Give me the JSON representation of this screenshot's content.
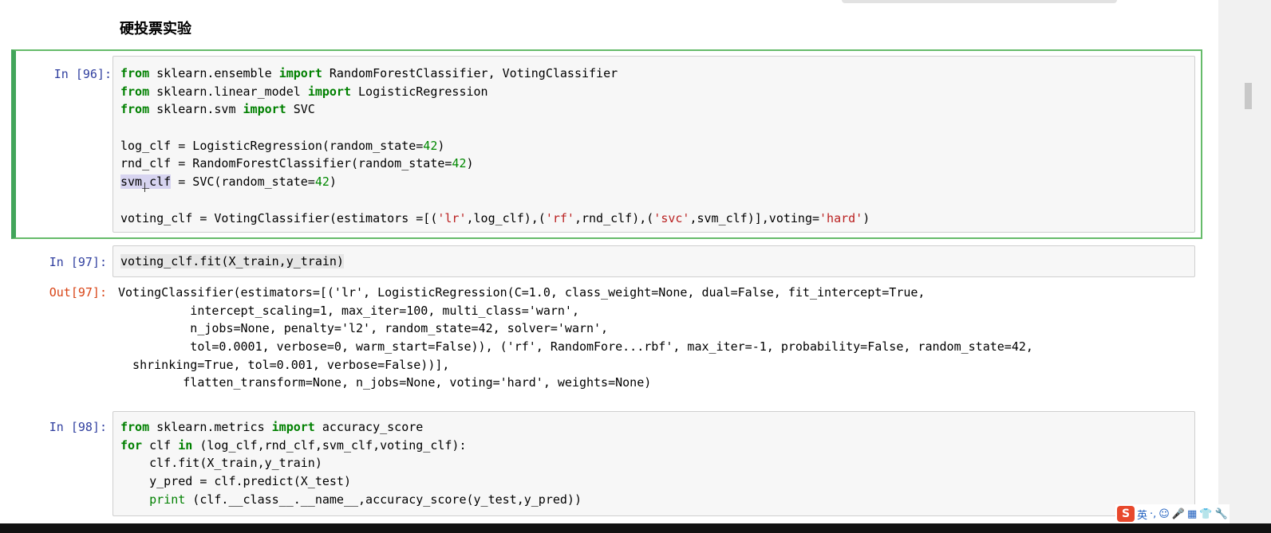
{
  "heading": "硬投票实验",
  "cells": [
    {
      "prompt": "In [96]:",
      "lines": [
        [
          {
            "t": "from",
            "c": "kw"
          },
          {
            "t": " sklearn.ensemble "
          },
          {
            "t": "import",
            "c": "kw"
          },
          {
            "t": " RandomForestClassifier, VotingClassifier"
          }
        ],
        [
          {
            "t": "from",
            "c": "kw"
          },
          {
            "t": " sklearn.linear_model "
          },
          {
            "t": "import",
            "c": "kw"
          },
          {
            "t": " LogisticRegression"
          }
        ],
        [
          {
            "t": "from",
            "c": "kw"
          },
          {
            "t": " sklearn.svm "
          },
          {
            "t": "import",
            "c": "kw"
          },
          {
            "t": " SVC"
          }
        ],
        [],
        [
          {
            "t": "log_clf = LogisticRegression(random_state="
          },
          {
            "t": "42",
            "c": "num"
          },
          {
            "t": ")"
          }
        ],
        [
          {
            "t": "rnd_clf = RandomForestClassifier(random_state="
          },
          {
            "t": "42",
            "c": "num"
          },
          {
            "t": ")"
          }
        ],
        [
          {
            "t": "svm_clf",
            "c": "sel-word"
          },
          {
            "t": " = SVC(random_state="
          },
          {
            "t": "42",
            "c": "num"
          },
          {
            "t": ")"
          }
        ],
        [],
        [
          {
            "t": "voting_clf = VotingClassifier(estimators =[("
          },
          {
            "t": "'lr'",
            "c": "str"
          },
          {
            "t": ",log_clf),("
          },
          {
            "t": "'rf'",
            "c": "str"
          },
          {
            "t": ",rnd_clf),("
          },
          {
            "t": "'svc'",
            "c": "str"
          },
          {
            "t": ",svm_clf)],voting="
          },
          {
            "t": "'hard'",
            "c": "str"
          },
          {
            "t": ")"
          }
        ]
      ]
    },
    {
      "prompt": "In [97]:",
      "lines": [
        [
          {
            "t": "voting_clf.fit(X_train,y_train)",
            "c": "hl"
          }
        ]
      ]
    },
    {
      "prompt": "In [98]:",
      "lines": [
        [
          {
            "t": "from",
            "c": "kw"
          },
          {
            "t": " sklearn.metrics "
          },
          {
            "t": "import",
            "c": "kw"
          },
          {
            "t": " accuracy_score"
          }
        ],
        [
          {
            "t": "for",
            "c": "kw"
          },
          {
            "t": " clf "
          },
          {
            "t": "in",
            "c": "kw"
          },
          {
            "t": " (log_clf,rnd_clf,svm_clf,voting_clf):"
          }
        ],
        [
          {
            "t": "    clf.fit(X_train,y_train)"
          }
        ],
        [
          {
            "t": "    y_pred = clf.predict(X_test)"
          }
        ],
        [
          {
            "t": "    "
          },
          {
            "t": "print",
            "c": "bi"
          },
          {
            "t": " (clf.__class__.__name__,accuracy_score(y_test,y_pred))"
          }
        ]
      ]
    }
  ],
  "output": {
    "prompt": "Out[97]:",
    "lines": [
      "VotingClassifier(estimators=[('lr', LogisticRegression(C=1.0, class_weight=None, dual=False, fit_intercept=True,",
      "          intercept_scaling=1, max_iter=100, multi_class='warn',",
      "          n_jobs=None, penalty='l2', random_state=42, solver='warn',",
      "          tol=0.0001, verbose=0, warm_start=False)), ('rf', RandomFore...rbf', max_iter=-1, probability=False, random_state=42,",
      "  shrinking=True, tol=0.001, verbose=False))],",
      "         flatten_transform=None, n_jobs=None, voting='hard', weights=None)"
    ]
  },
  "ime": {
    "logo": "S",
    "items": [
      "英",
      "·,",
      "☺",
      "🎤",
      "▦",
      "👕",
      "🔧"
    ]
  }
}
